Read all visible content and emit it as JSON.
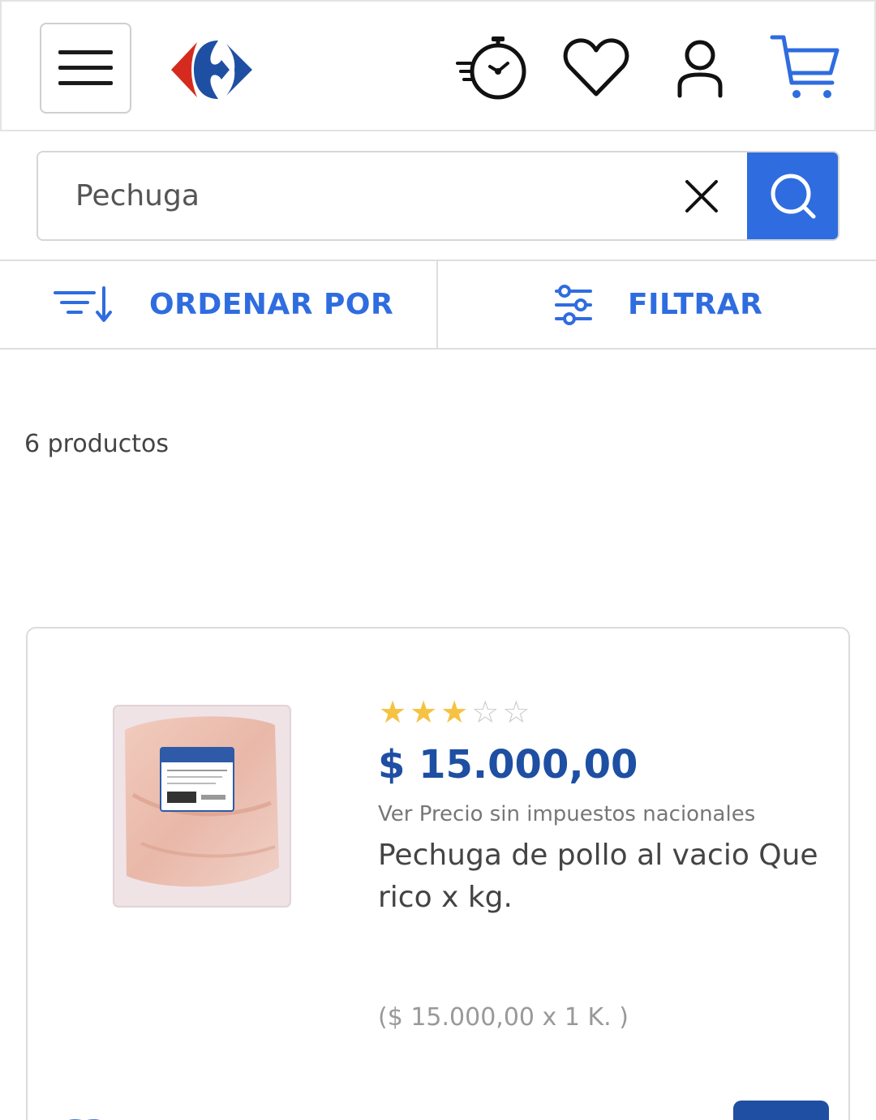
{
  "header": {
    "menu_icon": "hamburger-menu-icon",
    "logo": "carrefour-logo",
    "icons": [
      "express-stopwatch-icon",
      "heart-icon",
      "user-icon",
      "cart-icon"
    ],
    "colors": {
      "brand_blue": "#2f6cdf",
      "logo_red": "#d52b1e",
      "logo_blue": "#1e4fa3"
    }
  },
  "search": {
    "value": "Pechuga",
    "clear_icon": "close-icon",
    "submit_icon": "search-icon"
  },
  "toolbar": {
    "sort_label": "ORDENAR POR",
    "filter_label": "FILTRAR"
  },
  "results": {
    "count_text": "6 productos"
  },
  "products": [
    {
      "rating": 3,
      "rating_max": 5,
      "price": "$ 15.000,00",
      "tax_link": "Ver Precio sin impuestos nacionales",
      "name": "Pechuga de pollo al vacio Que rico x kg.",
      "unit_price": "($ 15.000,00 x 1 K. )",
      "image": "vacuum-packed-chicken-breast-photo"
    }
  ]
}
